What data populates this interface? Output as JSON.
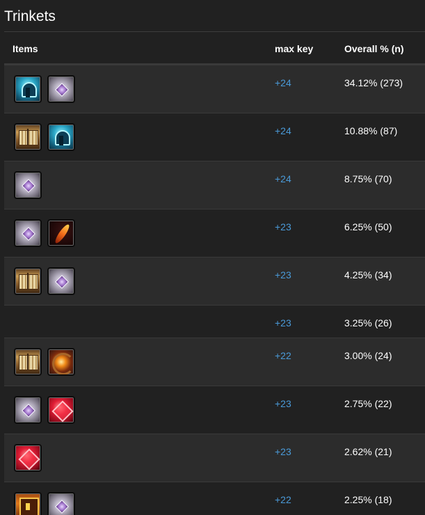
{
  "section": {
    "title": "Trinkets"
  },
  "table": {
    "headers": {
      "items": "Items",
      "max_key": "max key",
      "overall": "Overall % (n)"
    },
    "rows": [
      {
        "icons": [
          "blue-helm-icon",
          "silver-gem-icon"
        ],
        "max_key": "+24",
        "overall": "34.12% (273)"
      },
      {
        "icons": [
          "tome-icon",
          "blue-helm-icon"
        ],
        "max_key": "+24",
        "overall": "10.88% (87)"
      },
      {
        "icons": [
          "silver-gem-icon"
        ],
        "max_key": "+24",
        "overall": "8.75% (70)"
      },
      {
        "icons": [
          "silver-gem-icon",
          "phoenix-feather-icon"
        ],
        "max_key": "+23",
        "overall": "6.25% (50)"
      },
      {
        "icons": [
          "tome-icon",
          "silver-gem-icon"
        ],
        "max_key": "+23",
        "overall": "4.25% (34)"
      },
      {
        "icons": [],
        "max_key": "+23",
        "overall": "3.25% (26)"
      },
      {
        "icons": [
          "tome-icon",
          "fire-orb-icon"
        ],
        "max_key": "+22",
        "overall": "3.00% (24)"
      },
      {
        "icons": [
          "silver-gem-icon",
          "red-gem-icon"
        ],
        "max_key": "+23",
        "overall": "2.75% (22)"
      },
      {
        "icons": [
          "red-gem-icon"
        ],
        "max_key": "+23",
        "overall": "2.62% (21)"
      },
      {
        "icons": [
          "treasure-chest-icon",
          "silver-gem-icon"
        ],
        "max_key": "+22",
        "overall": "2.25% (18)"
      }
    ]
  },
  "colors": {
    "background": "#212121",
    "row_alt": "#2c2c2c",
    "link_blue": "#4a9ad8"
  }
}
